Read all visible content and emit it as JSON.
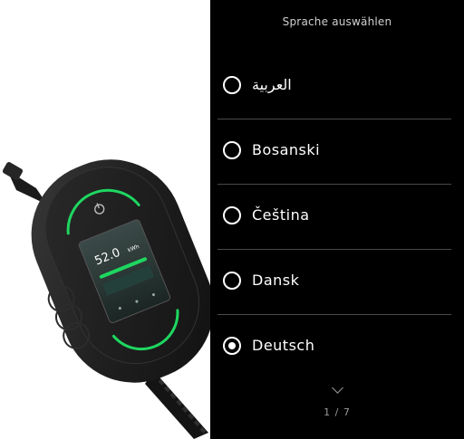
{
  "screen": {
    "title": "Sprache auswählen",
    "languages": [
      {
        "label": "العربية",
        "selected": false
      },
      {
        "label": "Bosanski",
        "selected": false
      },
      {
        "label": "Čeština",
        "selected": false
      },
      {
        "label": "Dansk",
        "selected": false
      },
      {
        "label": "Deutsch",
        "selected": true
      }
    ],
    "pager": {
      "text": "1 / 7",
      "icon": "chevron-down-icon"
    }
  },
  "device": {
    "display_value": "52.0",
    "display_unit": "kWh",
    "accent_color": "#1ed760",
    "icon": "power-icon"
  },
  "colors": {
    "screen_bg": "#000000",
    "text": "#ffffff",
    "divider": "#4a4a4a"
  }
}
